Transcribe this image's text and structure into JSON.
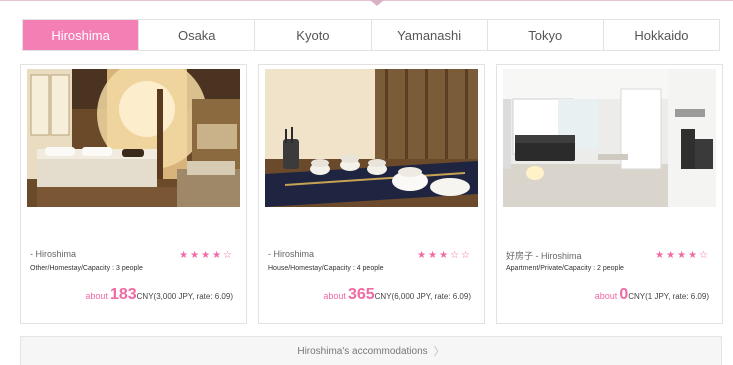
{
  "tabs": [
    {
      "label": "Hiroshima",
      "active": true
    },
    {
      "label": "Osaka",
      "active": false
    },
    {
      "label": "Kyoto",
      "active": false
    },
    {
      "label": "Yamanashi",
      "active": false
    },
    {
      "label": "Tokyo",
      "active": false
    },
    {
      "label": "Hokkaido",
      "active": false
    }
  ],
  "cards": [
    {
      "location": "- Hiroshima",
      "meta": "Other/Homestay/Capacity : 3 people",
      "rating": 4,
      "price_prefix": "about",
      "price_value": "183",
      "price_suffix": "CNY(3,000 JPY, rate: 6.09)"
    },
    {
      "location": "- Hiroshima",
      "meta": "House/Homestay/Capacity : 4 people",
      "rating": 3,
      "price_prefix": "about",
      "price_value": "365",
      "price_suffix": "CNY(6,000 JPY, rate: 6.09)"
    },
    {
      "location": "好房子 - Hiroshima",
      "meta": "Apartment/Private/Capacity : 2 people",
      "rating": 4,
      "price_prefix": "about",
      "price_value": "0",
      "price_suffix": "CNY(1 JPY, rate: 6.09)"
    }
  ],
  "footer": {
    "label": "Hiroshima's accommodations",
    "chevron": "〉"
  },
  "colors": {
    "accent": "#f47fb4",
    "price": "#f06aa5",
    "star_filled": "★",
    "star_empty": "☆"
  },
  "icons": {
    "star_filled": "star-filled-icon",
    "star_empty": "star-empty-icon",
    "chevron": "chevron-right-icon"
  }
}
